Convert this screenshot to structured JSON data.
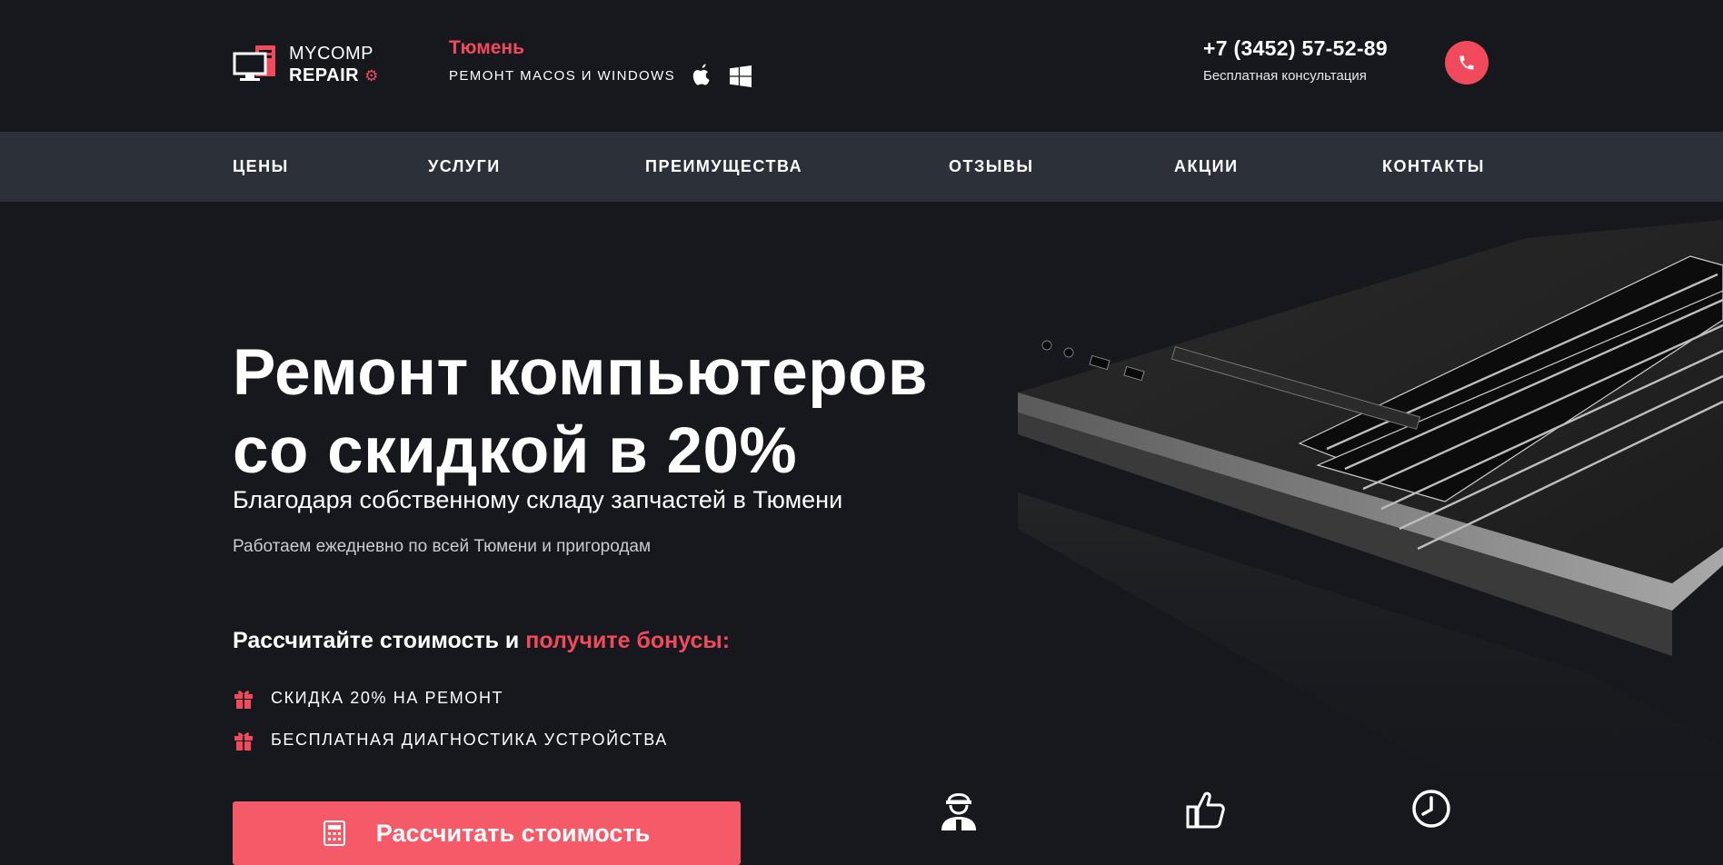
{
  "header": {
    "logo": {
      "line1": "MYCOMP",
      "line2": "REPAIR",
      "gear": "⚙"
    },
    "city": "Тюмень",
    "subtitle": "РЕМОНТ MACOS И WINDOWS",
    "os_icons": [
      "apple-icon",
      "windows-icon"
    ],
    "phone": "+7 (3452) 57-52-89",
    "consultation": "Бесплатная консультация",
    "call_icon": "phone-icon"
  },
  "nav": {
    "items": [
      {
        "label": "ЦЕНЫ"
      },
      {
        "label": "УСЛУГИ"
      },
      {
        "label": "ПРЕИМУЩЕСТВА"
      },
      {
        "label": "ОТЗЫВЫ"
      },
      {
        "label": "АКЦИИ"
      },
      {
        "label": "КОНТАКТЫ"
      }
    ]
  },
  "hero": {
    "title_line1": "Ремонт компьютеров",
    "title_line2": "со скидкой в 20%",
    "subtitle": "Благодаря собственному складу запчастей в Тюмени",
    "note": "Работаем ежедневно по всей Тюмени и пригородам"
  },
  "calc": {
    "title_start": "Рассчитайте стоимость и ",
    "title_accent": "получите бонусы:",
    "bonuses": [
      {
        "icon": "gift-icon",
        "text": "СКИДКА 20% НА РЕМОНТ"
      },
      {
        "icon": "gift-icon",
        "text": "БЕСПЛАТНАЯ ДИАГНОСТИКА УСТРОЙСТВА"
      }
    ],
    "button_label": "Рассчитать стоимость",
    "button_icon": "calculator-icon"
  },
  "features": {
    "icons": [
      "technician-icon",
      "thumbs-up-icon",
      "clock-icon"
    ]
  },
  "colors": {
    "background": "#16181d",
    "nav_background": "#2c3038",
    "accent": "#f04a5c",
    "button": "#f45a67"
  }
}
